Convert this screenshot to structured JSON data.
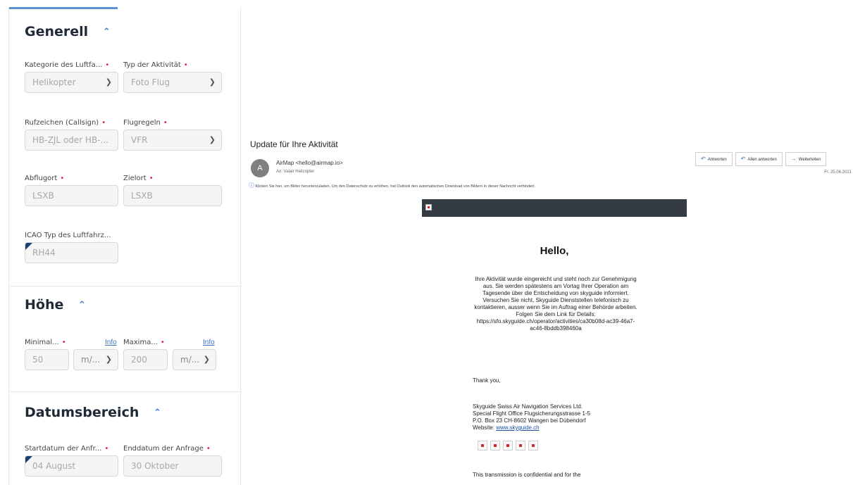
{
  "form": {
    "sections": {
      "general": "Generell",
      "height": "Höhe",
      "date_range": "Datumsbereich"
    },
    "required_marker": "•",
    "aircraft_category": {
      "label": "Kategorie des Luftfa...",
      "value": "Helikopter"
    },
    "activity_type": {
      "label": "Typ der Aktivität",
      "value": "Foto Flug"
    },
    "callsign": {
      "label": "Rufzeichen (Callsign)",
      "value": "HB-ZJL oder HB-..."
    },
    "flight_rules": {
      "label": "Flugregeln",
      "value": "VFR"
    },
    "departure": {
      "label": "Abflugort",
      "value": "LSXB"
    },
    "destination": {
      "label": "Zielort",
      "value": "LSXB"
    },
    "icao_type": {
      "label": "ICAO Typ des Luftfahrz...",
      "value": "RH44"
    },
    "min_height": {
      "label": "Minimal...",
      "info": "Info",
      "value": "50",
      "unit": "m/..."
    },
    "max_height": {
      "label": "Maxima...",
      "info": "Info",
      "value": "200",
      "unit": "m/..."
    },
    "start_date": {
      "label": "Startdatum der Anfr...",
      "value": "04 August"
    },
    "end_date": {
      "label": "Enddatum der Anfrage",
      "value": "30 Oktober"
    }
  },
  "email": {
    "subject": "Update für Ihre Aktivität",
    "avatar_letter": "A",
    "sender": "AirMap <hello@airmap.io>",
    "to": "An: Valair Helicopter",
    "notice": "Klicken Sie hier, um Bilder herunterzuladen. Um den Datenschutz zu erhöhen, hat Outlook den automatischen Download von Bildern in dieser Nachricht verhindert.",
    "actions": {
      "reply": "Antworten",
      "reply_all": "Allen antworten",
      "forward": "Weiterleiten"
    },
    "date": "Fr. 25.06.2021",
    "greeting": "Hello,",
    "paragraph": "Ihre Aktivität wurde eingereicht und steht noch zur Genehmigung aus. Sie werden spätestens am Vortag Ihrer Operation am Tagesende über die Entscheidung von skyguide informiert. Versuchen Sie nicht, Skyguide Dienststellen telefonisch zu kontaktieren, ausser wenn Sie im Auftrag einer Behörde arbeiten. Folgen Sie dem Link für Details: https://sfo.skyguide.ch/operator/activities/ca30b08d-ac39-46a7-ac46-8bddb398460a",
    "thanks": "Thank you,",
    "signature": {
      "line1": "Skyguide Swiss Air Navigation Services Ltd.",
      "line2": "Special Flight Office Flugsicherungsstrasse 1-5",
      "line3": "P.O. Box 23 CH-8602 Wangen bei Dübendorf",
      "website_label": "Website:",
      "website": "www.skyguide.ch"
    },
    "confidential": "This transmission is confidential and for the"
  }
}
